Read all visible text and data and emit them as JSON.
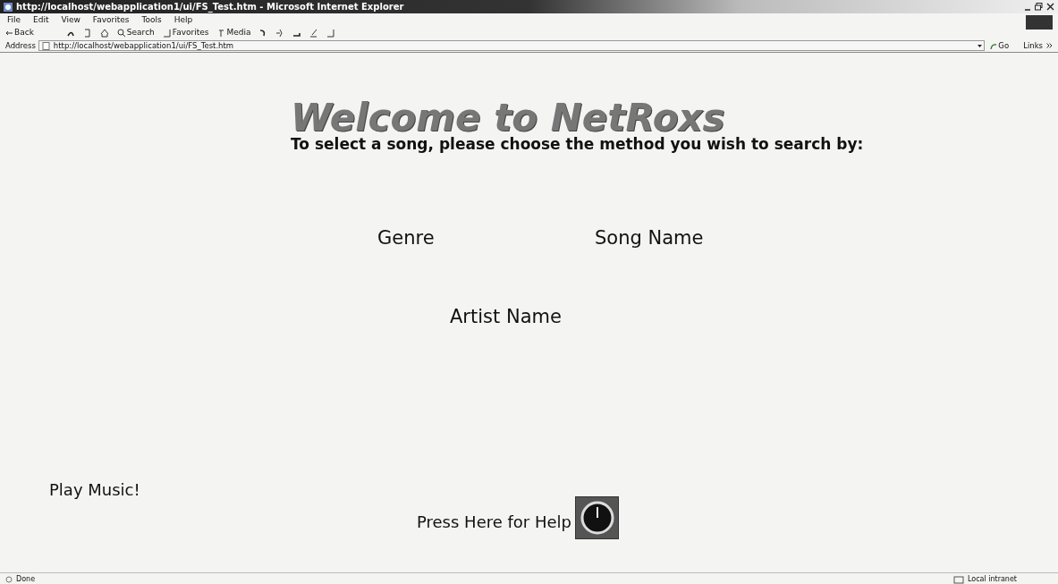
{
  "window": {
    "title": "http://localhost/webapplication1/ui/FS_Test.htm - Microsoft Internet Explorer"
  },
  "menu": [
    "File",
    "Edit",
    "View",
    "Favorites",
    "Tools",
    "Help"
  ],
  "toolbar": [
    {
      "kind": "back",
      "label": "Back"
    },
    {
      "kind": "icon"
    },
    {
      "kind": "icon"
    },
    {
      "kind": "icon"
    },
    {
      "kind": "labeled",
      "label": "Search"
    },
    {
      "kind": "labeled",
      "label": "Favorites"
    },
    {
      "kind": "labeled",
      "label": "Media"
    },
    {
      "kind": "icon"
    },
    {
      "kind": "icon"
    },
    {
      "kind": "icon"
    },
    {
      "kind": "icon"
    },
    {
      "kind": "icon"
    }
  ],
  "address": {
    "label": "Address",
    "value": "http://localhost/webapplication1/ui/FS_Test.htm",
    "go": "Go",
    "links": "Links"
  },
  "page": {
    "heading": "Welcome to NetRoxs",
    "instruction": "To select a song, please choose the method you wish to search by:",
    "methods": [
      "Genre",
      "Song Name",
      "Artist Name"
    ],
    "play": "Play Music!",
    "help": "Press Here for Help"
  },
  "status_bar": {
    "text": "Done",
    "zone": "Local intranet"
  }
}
